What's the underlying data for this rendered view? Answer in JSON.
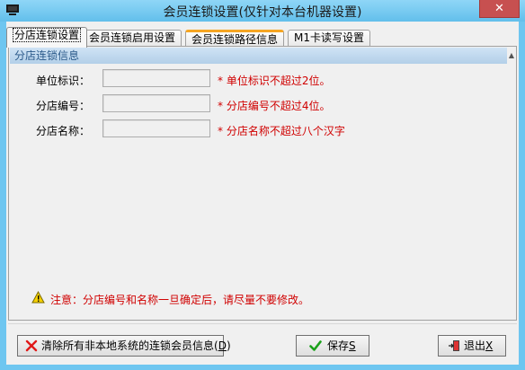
{
  "window": {
    "title": "会员连锁设置(仅针对本台机器设置)",
    "close_glyph": "✕"
  },
  "tabs": [
    {
      "label": "分店连锁设置"
    },
    {
      "label": "会员连锁启用设置"
    },
    {
      "label": "会员连锁路径信息"
    },
    {
      "label": "M1卡读写设置"
    }
  ],
  "group": {
    "title": "分店连锁信息"
  },
  "fields": {
    "unit_id": {
      "label": "单位标识：",
      "value": "",
      "hint": "* 单位标识不超过2位。"
    },
    "branch_no": {
      "label": "分店编号：",
      "value": "",
      "hint": "* 分店编号不超过4位。"
    },
    "branch_name": {
      "label": "分店名称：",
      "value": "",
      "hint": "* 分店名称不超过八个汉字"
    }
  },
  "note": "注意：分店编号和名称一旦确定后，请尽量不要修改。",
  "buttons": {
    "clear": {
      "label": "清除所有非本地系统的连锁会员信息",
      "hotkey": "D"
    },
    "save": {
      "label": "保存",
      "hotkey": "S"
    },
    "exit": {
      "label": "退出",
      "hotkey": "X"
    }
  },
  "colors": {
    "titlebar": "#6ec6f0",
    "hint": "#d00000",
    "group_header": "#c3d9ee",
    "close_button": "#c75050"
  },
  "icons": {
    "app": "window-icon",
    "warning": "warning-icon",
    "clear": "red-x-icon",
    "save": "green-check-icon",
    "exit": "exit-door-icon"
  }
}
